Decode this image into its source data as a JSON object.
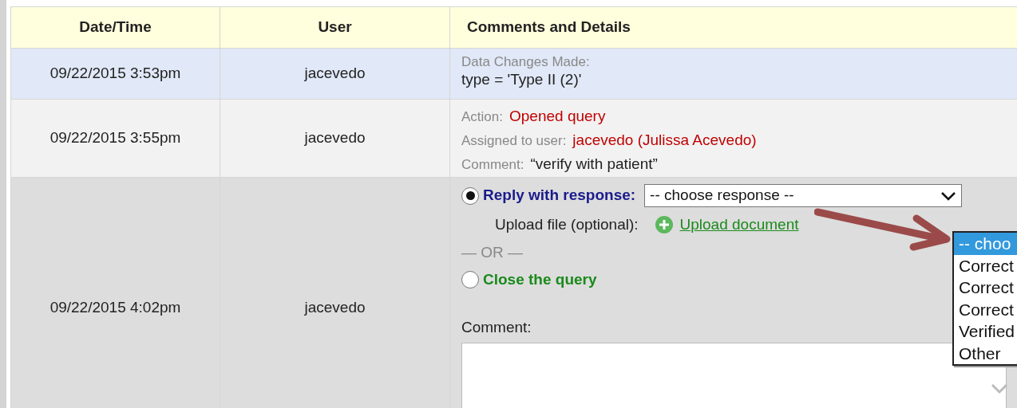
{
  "table": {
    "columns": [
      "Date/Time",
      "User",
      "Comments and Details"
    ],
    "rows": [
      {
        "kind": "change",
        "datetime": "09/22/2015 3:53pm",
        "user": "jacevedo",
        "label": "Data Changes Made:",
        "value": "type = 'Type II (2)'"
      },
      {
        "kind": "query",
        "datetime": "09/22/2015 3:55pm",
        "user": "jacevedo",
        "fields": [
          {
            "label": "Action:",
            "value": "Opened query",
            "kind": "status"
          },
          {
            "label": "Assigned to user:",
            "value": "jacevedo (Julissa Acevedo)",
            "kind": "status"
          },
          {
            "label": "Comment:",
            "value": "“verify with patient”",
            "kind": "plain"
          }
        ]
      },
      {
        "kind": "reply",
        "datetime": "09/22/2015 4:02pm",
        "user": "jacevedo",
        "options": [
          {
            "label": "Reply with response:",
            "selected": true
          },
          {
            "label": "Close the query",
            "selected": false
          }
        ],
        "response_select": {
          "value": "-- choose response --"
        },
        "upload_label": "Upload file (optional):",
        "upload_link": "Upload document",
        "separator": "— OR —",
        "comment_label": "Comment:",
        "dropdown_list": [
          {
            "label": "-- choo",
            "selected": true
          },
          {
            "label": "Correct",
            "selected": false
          },
          {
            "label": "Correct",
            "selected": false
          },
          {
            "label": "Correct",
            "selected": false
          },
          {
            "label": "Verified",
            "selected": false
          },
          {
            "label": "Other",
            "selected": false
          }
        ]
      }
    ]
  }
}
